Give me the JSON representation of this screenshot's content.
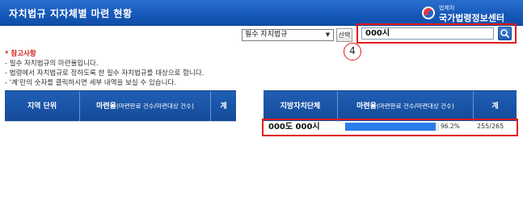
{
  "header": {
    "title": "자치법규 지자체별 마련 현황",
    "logo_small": "법제처",
    "logo_main": "국가법령정보센터"
  },
  "filter": {
    "selected_option": "필수 자치법규",
    "select_button": "선택",
    "search_value": "000시"
  },
  "callout": {
    "number": "4"
  },
  "notes": {
    "title": "* 참고사항",
    "lines": [
      "- 필수 자치법규의 마련율입니다.",
      "- 법령에서 자치법규로 정하도록 한 필수 자치법규를 대상으로 합니다.",
      "- '계'란의 숫자를 클릭하시면 세부 내역을 보실 수 있습니다."
    ]
  },
  "left_table": {
    "headers": {
      "region": "지역 단위",
      "rate": "마련율",
      "rate_sub": "(마련완료 건수/마련대상 건수)",
      "total": "계"
    }
  },
  "right_table": {
    "headers": {
      "region": "지방자치단체",
      "rate": "마련율",
      "rate_sub": "(마련완료 건수/마련대상 건수)",
      "total": "계"
    },
    "row": {
      "region": "000도 000시",
      "rate_percent": 96.2,
      "rate_label": "96.2%",
      "total": "255/265"
    }
  },
  "colors": {
    "header_blue": "#1558b8",
    "highlight_red": "#e31b1b",
    "bar_blue": "#2b7de9"
  },
  "icons": {
    "search_button": "magnifier-icon",
    "logo": "government-emblem-icon"
  }
}
